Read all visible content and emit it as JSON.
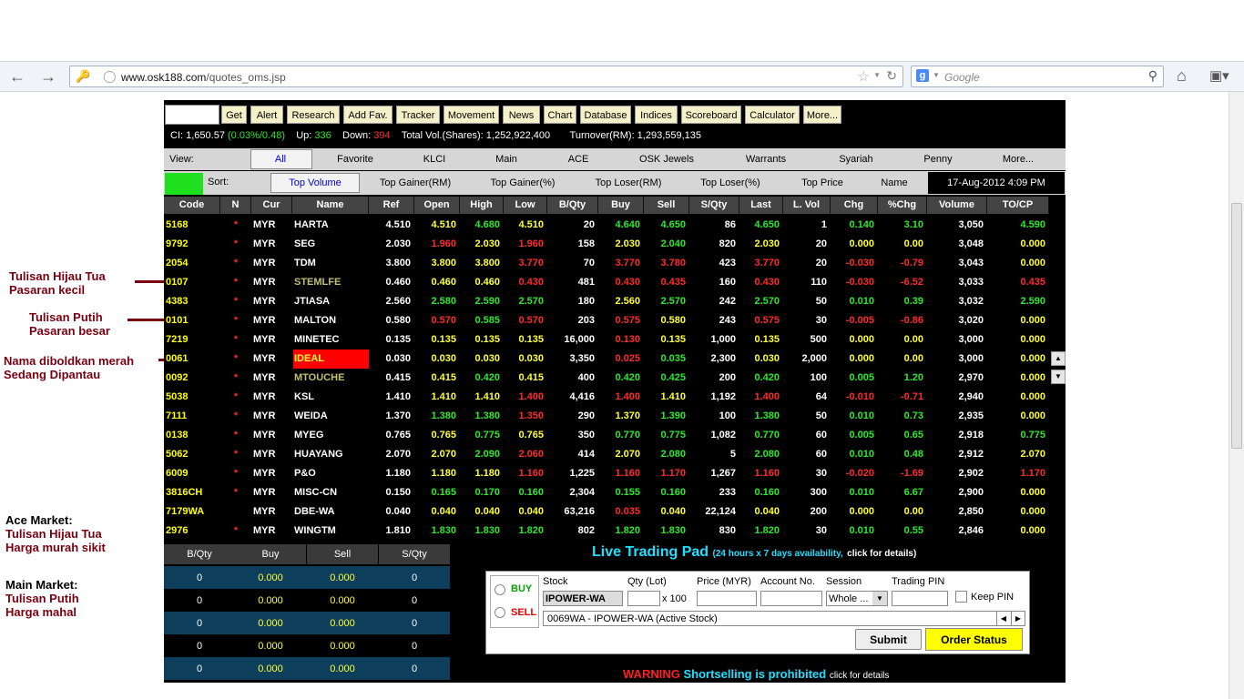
{
  "browser": {
    "url_host": "www.osk188.com",
    "url_path": "/quotes_oms.jsp",
    "search_placeholder": "Google"
  },
  "toolbar": {
    "buttons": [
      "Get",
      "Alert",
      "Research",
      "Add Fav.",
      "Tracker",
      "Movement",
      "News",
      "Chart",
      "Database",
      "Indices",
      "Scoreboard",
      "Calculator",
      "More..."
    ]
  },
  "ticker": {
    "ci_label": "CI: 1,650.57",
    "ci_change": "(0.03%/0.48)",
    "up_label": "Up:",
    "up_value": "336",
    "down_label": "Down:",
    "down_value": "394",
    "total_vol": "Total Vol.(Shares): 1,252,922,400",
    "turnover": "Turnover(RM): 1,293,559,135"
  },
  "view": {
    "label": "View:",
    "tabs": [
      "All",
      "Favorite",
      "KLCI",
      "Main",
      "ACE",
      "OSK Jewels",
      "Warrants",
      "Syariah",
      "Penny",
      "More..."
    ]
  },
  "sort": {
    "label": "Sort:",
    "options": [
      "Top Volume",
      "Top Gainer(RM)",
      "Top Gainer(%)",
      "Top Loser(RM)",
      "Top Loser(%)",
      "Top Price",
      "Name"
    ],
    "datetime": "17-Aug-2012 4:09 PM"
  },
  "table": {
    "headers": [
      "Code",
      "N",
      "Cur",
      "Name",
      "Ref",
      "Open",
      "High",
      "Low",
      "B/Qty",
      "Buy",
      "Sell",
      "S/Qty",
      "Last",
      "L. Vol",
      "Chg",
      "%Chg",
      "Volume",
      "TO/CP"
    ],
    "rows": [
      {
        "code": "5168",
        "n": "*",
        "cur": "MYR",
        "name": "HARTA",
        "ref": "4.510",
        "open": "4.510",
        "high": "4.680",
        "low": "4.510",
        "bqty": "20",
        "buy": "4.640",
        "sell": "4.650",
        "sqty": "86",
        "last": "4.650",
        "lvol": "1",
        "chg": "0.140",
        "pchg": "3.10",
        "volume": "3,050",
        "tocp": "4.590"
      },
      {
        "code": "9792",
        "n": "*",
        "cur": "MYR",
        "name": "SEG",
        "ref": "2.030",
        "open": "1.960",
        "high": "2.030",
        "low": "1.960",
        "bqty": "158",
        "buy": "2.030",
        "sell": "2.040",
        "sqty": "820",
        "last": "2.030",
        "lvol": "20",
        "chg": "0.000",
        "pchg": "0.00",
        "volume": "3,048",
        "tocp": "0.000"
      },
      {
        "code": "2054",
        "n": "*",
        "cur": "MYR",
        "name": "TDM",
        "ref": "3.800",
        "open": "3.800",
        "high": "3.800",
        "low": "3.770",
        "bqty": "70",
        "buy": "3.770",
        "sell": "3.780",
        "sqty": "423",
        "last": "3.770",
        "lvol": "20",
        "chg": "-0.030",
        "pchg": "-0.79",
        "volume": "3,043",
        "tocp": "0.000"
      },
      {
        "code": "0107",
        "n": "*",
        "cur": "MYR",
        "name": "STEMLFE",
        "ref": "0.460",
        "open": "0.460",
        "high": "0.460",
        "low": "0.430",
        "bqty": "481",
        "buy": "0.430",
        "sell": "0.435",
        "sqty": "160",
        "last": "0.430",
        "lvol": "110",
        "chg": "-0.030",
        "pchg": "-6.52",
        "volume": "3,033",
        "tocp": "0.435"
      },
      {
        "code": "4383",
        "n": "*",
        "cur": "MYR",
        "name": "JTIASA",
        "ref": "2.560",
        "open": "2.580",
        "high": "2.590",
        "low": "2.570",
        "bqty": "180",
        "buy": "2.560",
        "sell": "2.570",
        "sqty": "242",
        "last": "2.570",
        "lvol": "50",
        "chg": "0.010",
        "pchg": "0.39",
        "volume": "3,032",
        "tocp": "2.590"
      },
      {
        "code": "0101",
        "n": "*",
        "cur": "MYR",
        "name": "MALTON",
        "ref": "0.580",
        "open": "0.570",
        "high": "0.585",
        "low": "0.570",
        "bqty": "203",
        "buy": "0.575",
        "sell": "0.580",
        "sqty": "243",
        "last": "0.575",
        "lvol": "30",
        "chg": "-0.005",
        "pchg": "-0.86",
        "volume": "3,020",
        "tocp": "0.000"
      },
      {
        "code": "7219",
        "n": "*",
        "cur": "MYR",
        "name": "MINETEC",
        "ref": "0.135",
        "open": "0.135",
        "high": "0.135",
        "low": "0.135",
        "bqty": "16,000",
        "buy": "0.130",
        "sell": "0.135",
        "sqty": "1,000",
        "last": "0.135",
        "lvol": "500",
        "chg": "0.000",
        "pchg": "0.00",
        "volume": "3,000",
        "tocp": "0.000"
      },
      {
        "code": "0061",
        "n": "*",
        "cur": "MYR",
        "name": "IDEAL",
        "ref": "0.030",
        "open": "0.030",
        "high": "0.030",
        "low": "0.030",
        "bqty": "3,350",
        "buy": "0.025",
        "sell": "0.035",
        "sqty": "2,300",
        "last": "0.030",
        "lvol": "2,000",
        "chg": "0.000",
        "pchg": "0.00",
        "volume": "3,000",
        "tocp": "0.000"
      },
      {
        "code": "0092",
        "n": "*",
        "cur": "MYR",
        "name": "MTOUCHE",
        "ref": "0.415",
        "open": "0.415",
        "high": "0.420",
        "low": "0.415",
        "bqty": "400",
        "buy": "0.420",
        "sell": "0.425",
        "sqty": "200",
        "last": "0.420",
        "lvol": "100",
        "chg": "0.005",
        "pchg": "1.20",
        "volume": "2,970",
        "tocp": "0.000"
      },
      {
        "code": "5038",
        "n": "*",
        "cur": "MYR",
        "name": "KSL",
        "ref": "1.410",
        "open": "1.410",
        "high": "1.410",
        "low": "1.400",
        "bqty": "4,416",
        "buy": "1.400",
        "sell": "1.410",
        "sqty": "1,192",
        "last": "1.400",
        "lvol": "64",
        "chg": "-0.010",
        "pchg": "-0.71",
        "volume": "2,940",
        "tocp": "0.000"
      },
      {
        "code": "7111",
        "n": "*",
        "cur": "MYR",
        "name": "WEIDA",
        "ref": "1.370",
        "open": "1.380",
        "high": "1.380",
        "low": "1.350",
        "bqty": "290",
        "buy": "1.370",
        "sell": "1.390",
        "sqty": "100",
        "last": "1.380",
        "lvol": "50",
        "chg": "0.010",
        "pchg": "0.73",
        "volume": "2,935",
        "tocp": "0.000"
      },
      {
        "code": "0138",
        "n": "*",
        "cur": "MYR",
        "name": "MYEG",
        "ref": "0.765",
        "open": "0.765",
        "high": "0.775",
        "low": "0.765",
        "bqty": "350",
        "buy": "0.770",
        "sell": "0.775",
        "sqty": "1,082",
        "last": "0.770",
        "lvol": "60",
        "chg": "0.005",
        "pchg": "0.65",
        "volume": "2,918",
        "tocp": "0.775"
      },
      {
        "code": "5062",
        "n": "*",
        "cur": "MYR",
        "name": "HUAYANG",
        "ref": "2.070",
        "open": "2.070",
        "high": "2.090",
        "low": "2.060",
        "bqty": "414",
        "buy": "2.070",
        "sell": "2.080",
        "sqty": "5",
        "last": "2.080",
        "lvol": "60",
        "chg": "0.010",
        "pchg": "0.48",
        "volume": "2,912",
        "tocp": "2.070"
      },
      {
        "code": "6009",
        "n": "*",
        "cur": "MYR",
        "name": "P&O",
        "ref": "1.180",
        "open": "1.180",
        "high": "1.180",
        "low": "1.160",
        "bqty": "1,225",
        "buy": "1.160",
        "sell": "1.170",
        "sqty": "1,267",
        "last": "1.160",
        "lvol": "30",
        "chg": "-0.020",
        "pchg": "-1.69",
        "volume": "2,902",
        "tocp": "1.170"
      },
      {
        "code": "3816CH",
        "n": "*",
        "cur": "MYR",
        "name": "MISC-CN",
        "ref": "0.150",
        "open": "0.165",
        "high": "0.170",
        "low": "0.160",
        "bqty": "2,304",
        "buy": "0.155",
        "sell": "0.160",
        "sqty": "233",
        "last": "0.160",
        "lvol": "300",
        "chg": "0.010",
        "pchg": "6.67",
        "volume": "2,900",
        "tocp": "0.000"
      },
      {
        "code": "7179WA",
        "n": "",
        "cur": "MYR",
        "name": "DBE-WA",
        "ref": "0.040",
        "open": "0.040",
        "high": "0.040",
        "low": "0.040",
        "bqty": "63,216",
        "buy": "0.035",
        "sell": "0.040",
        "sqty": "22,124",
        "last": "0.040",
        "lvol": "200",
        "chg": "0.000",
        "pchg": "0.00",
        "volume": "2,850",
        "tocp": "0.000"
      },
      {
        "code": "2976",
        "n": "*",
        "cur": "MYR",
        "name": "WINGTM",
        "ref": "1.810",
        "open": "1.830",
        "high": "1.830",
        "low": "1.820",
        "bqty": "802",
        "buy": "1.820",
        "sell": "1.830",
        "sqty": "830",
        "last": "1.820",
        "lvol": "30",
        "chg": "0.010",
        "pchg": "0.55",
        "volume": "2,846",
        "tocp": "0.000"
      }
    ]
  },
  "depth": {
    "headers": [
      "B/Qty",
      "Buy",
      "Sell",
      "S/Qty"
    ],
    "rows": [
      [
        "0",
        "0.000",
        "0.000",
        "0"
      ],
      [
        "0",
        "0.000",
        "0.000",
        "0"
      ],
      [
        "0",
        "0.000",
        "0.000",
        "0"
      ],
      [
        "0",
        "0.000",
        "0.000",
        "0"
      ],
      [
        "0",
        "0.000",
        "0.000",
        "0"
      ]
    ]
  },
  "trading_pad": {
    "title": "Live Trading Pad",
    "availability": "(24 hours x 7 days availability,",
    "details": "click for details)",
    "buy": "BUY",
    "sell": "SELL",
    "stock_label": "Stock",
    "stock_value": "IPOWER-WA",
    "qty_label": "Qty (Lot)",
    "qty_suffix": "x 100",
    "price_label": "Price (MYR)",
    "account_label": "Account No.",
    "session_label": "Session",
    "session_value": "Whole ...",
    "pin_label": "Trading PIN",
    "keep_pin": "Keep PIN",
    "active_stock": "0069WA - IPOWER-WA (Active Stock)",
    "submit": "Submit",
    "order_status": "Order Status",
    "warning": "WARNING",
    "shortselling": "Shortselling is prohibited",
    "warning_details": "click for details"
  },
  "annotations": {
    "a1_l1": "Tulisan Hijau Tua",
    "a1_l2": "Pasaran kecil",
    "a2_l1": "Tulisan Putih",
    "a2_l2": "Pasaran besar",
    "a3_l1": "Nama diboldkan merah",
    "a3_l2": "Sedang Dipantau",
    "ace_title": "Ace Market:",
    "ace_l1": "Tulisan Hijau Tua",
    "ace_l2": "Harga murah sikit",
    "main_title": "Main Market:",
    "main_l1": "Tulisan Putih",
    "main_l2": "Harga mahal"
  },
  "colors": {
    "up": "#2ee82e",
    "down": "#ff2a2a",
    "code": "#ffff00",
    "ace_name": "#c0c070",
    "annotation": "#7a0010"
  }
}
